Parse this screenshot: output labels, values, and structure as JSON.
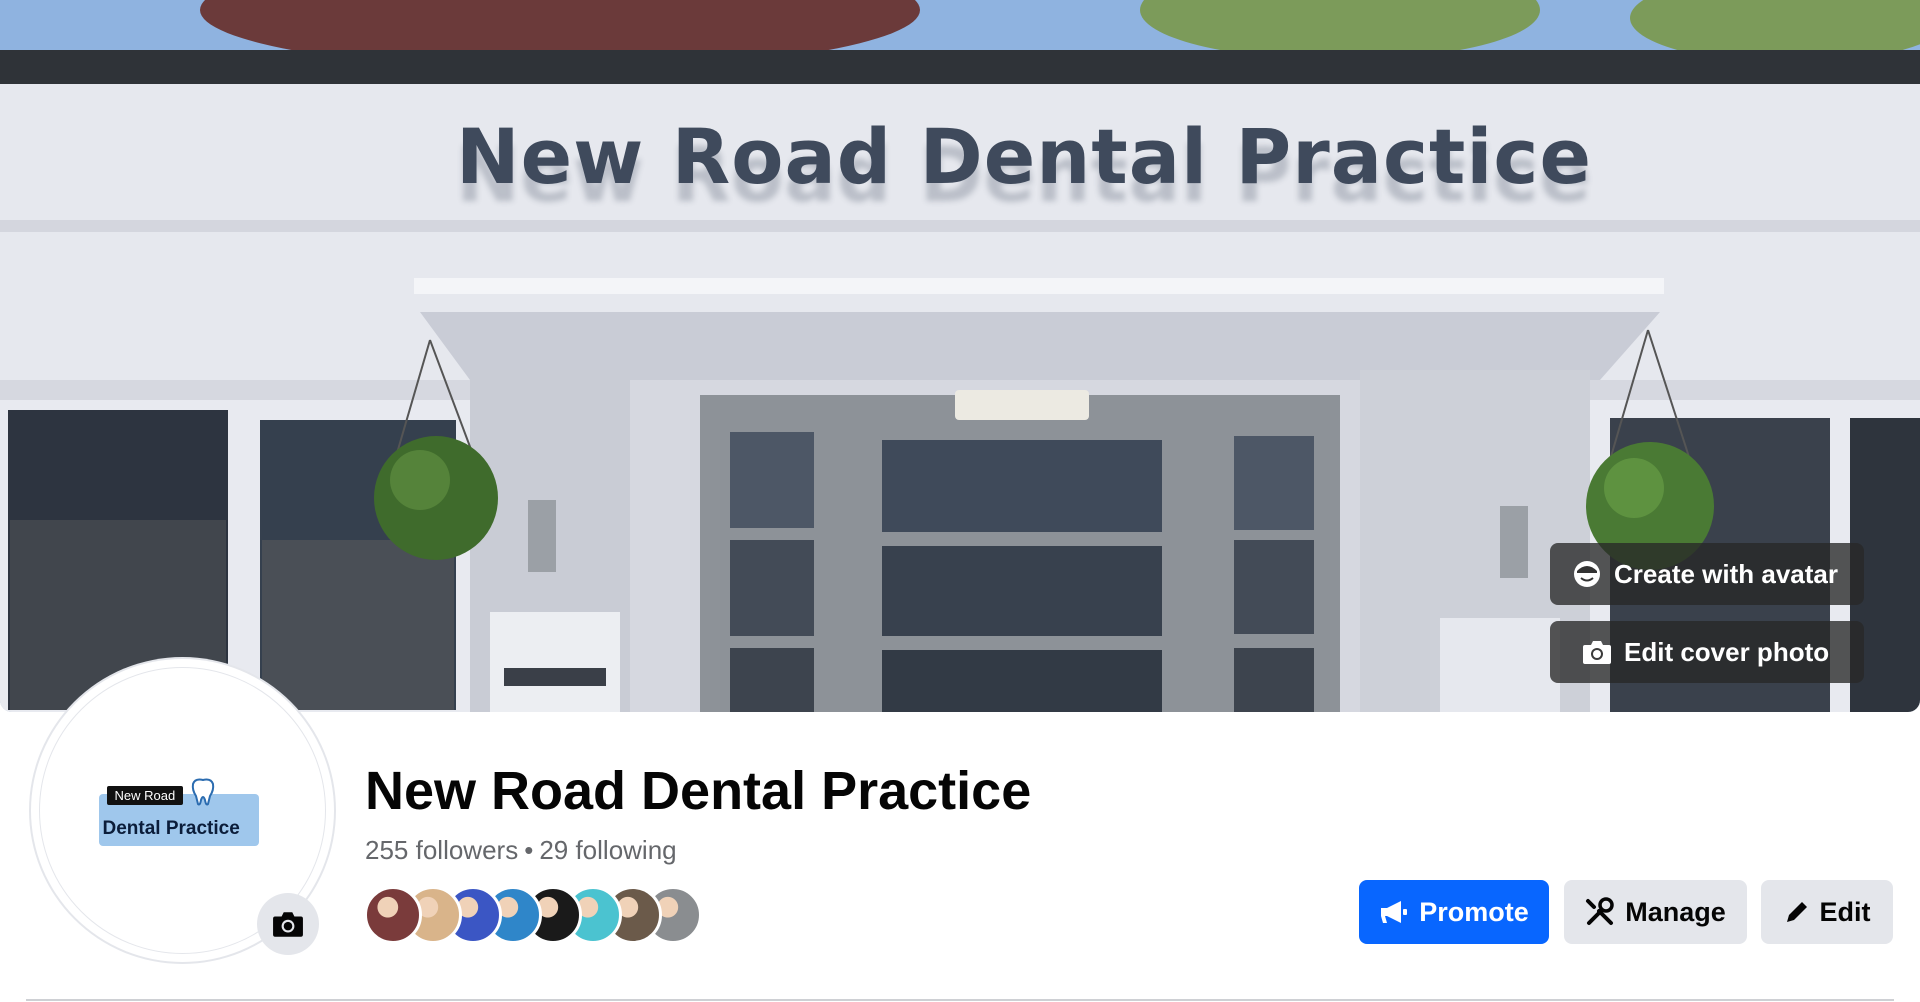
{
  "cover": {
    "sign_text": "New Road Dental Practice",
    "create_avatar_label": "Create with avatar",
    "edit_cover_label": "Edit cover photo"
  },
  "profile": {
    "logo_top": "New Road",
    "logo_main": "Dental Practice",
    "name": "New Road Dental Practice",
    "followers": "255 followers",
    "following": "29 following",
    "follower_avatars": [
      {
        "name": "follower-avatar-1",
        "color": "#7a3b3b"
      },
      {
        "name": "follower-avatar-2",
        "color": "#d9b48a"
      },
      {
        "name": "follower-avatar-3",
        "color": "#3b56c4"
      },
      {
        "name": "follower-avatar-4",
        "color": "#2f86c9"
      },
      {
        "name": "follower-avatar-5",
        "color": "#1a1a1a"
      },
      {
        "name": "follower-avatar-6",
        "color": "#4bc3d0"
      },
      {
        "name": "follower-avatar-7",
        "color": "#6b5a4a"
      },
      {
        "name": "follower-avatar-8",
        "color": "#8a8d90"
      }
    ]
  },
  "actions": {
    "promote": "Promote",
    "manage": "Manage",
    "edit": "Edit"
  },
  "colors": {
    "primary": "#0866ff",
    "secondary_button": "#e4e6eb",
    "text_secondary": "#65676b"
  }
}
